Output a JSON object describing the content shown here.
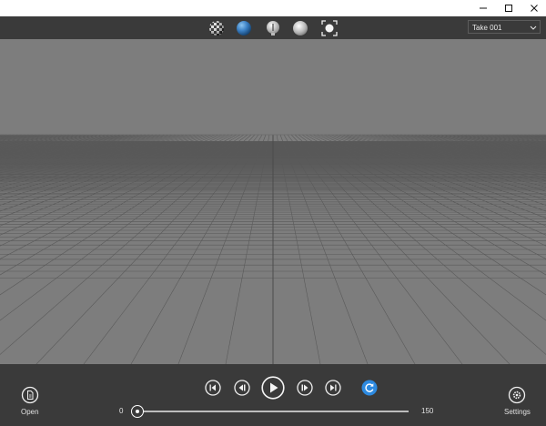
{
  "window": {
    "controls": [
      "minimize-icon",
      "maximize-icon",
      "close-icon"
    ]
  },
  "toolbar": {
    "tools": [
      "checker-material-icon",
      "blue-sphere-icon",
      "light-bulb-icon",
      "shaded-sphere-icon",
      "focus-frame-icon"
    ],
    "take_select": {
      "value": "Take 001"
    }
  },
  "playback": {
    "buttons": [
      "skip-to-start-icon",
      "step-back-icon",
      "play-icon",
      "step-forward-icon",
      "skip-to-end-icon",
      "loop-icon"
    ],
    "accent_color": "#2d8ae0",
    "timeline": {
      "min_label": "0",
      "max_label": "150",
      "position": 0
    }
  },
  "bottom_bar": {
    "open_label": "Open",
    "settings_label": "Settings"
  }
}
